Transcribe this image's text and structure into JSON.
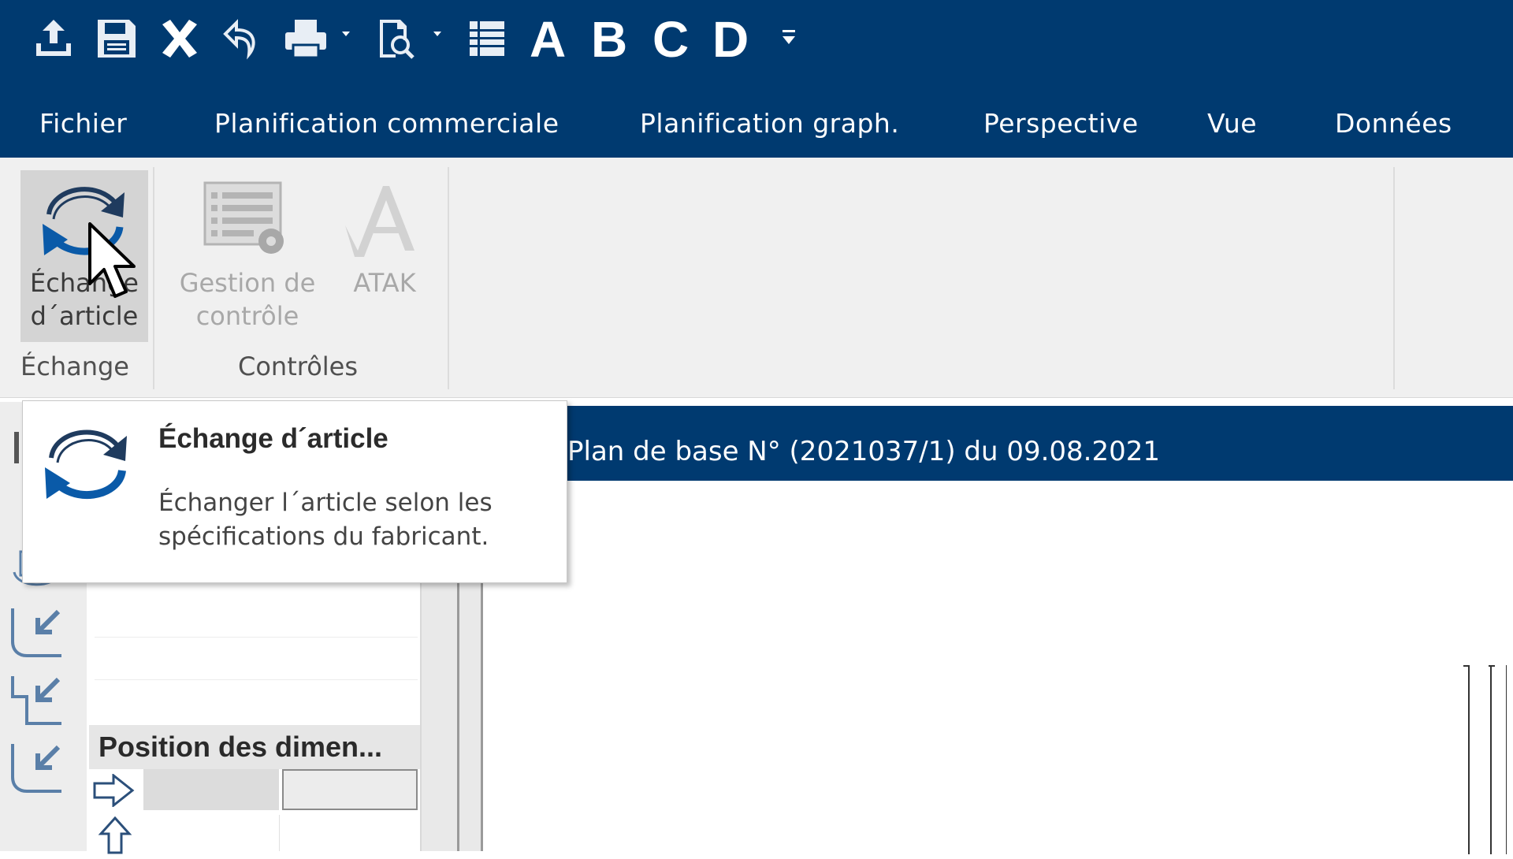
{
  "quick_access": {
    "icons": [
      "upload-icon",
      "save-icon",
      "close-icon",
      "undo-icon",
      "print-icon",
      "print-preview-icon",
      "list-icon"
    ],
    "letters": [
      "A",
      "B",
      "C",
      "D"
    ]
  },
  "menu": {
    "tabs": [
      "Fichier",
      "Planification commerciale",
      "Planification graph.",
      "Perspective",
      "Vue",
      "Données"
    ]
  },
  "ribbon": {
    "exchange_button": {
      "line1": "Échange",
      "line2": "d´article"
    },
    "control_button": {
      "line1": "Gestion de",
      "line2": "contrôle"
    },
    "atak_button": {
      "line1": "ATAK"
    },
    "group_exchange": "Échange",
    "group_controls": "Contrôles"
  },
  "tooltip": {
    "title": "Échange d´article",
    "description": "Échanger l´article selon les\nspécifications du fabricant."
  },
  "document": {
    "title": "Plan de base N° (2021037/1) du 09.08.2021"
  },
  "left_panel": {
    "header": "Position des dimen..."
  },
  "colors": {
    "brand_blue": "#003a70",
    "ribbon_bg": "#f0f0f0"
  }
}
